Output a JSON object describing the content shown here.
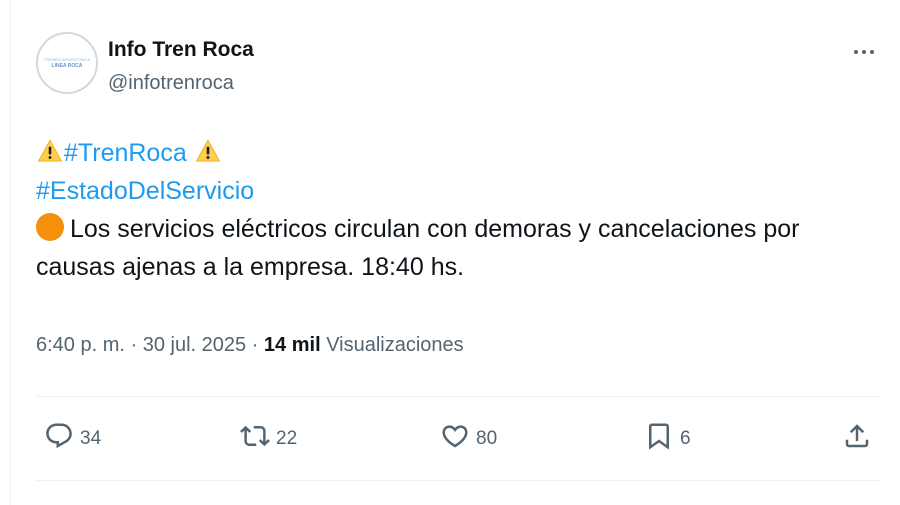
{
  "account": {
    "name": "Info Tren Roca",
    "handle": "@infotrenroca",
    "avatar_text_top": "TRENES ARGENTINOS",
    "avatar_text_bottom": "LINEA ROCA"
  },
  "tweet": {
    "hashtag_1": "#TrenRoca",
    "hashtag_2": "#EstadoDelServicio",
    "text_line_1": "Los servicios eléctricos circulan con demoras y cancelaciones por",
    "text_line_2": "causas ajenas a la empresa. 18:40 hs."
  },
  "meta": {
    "time": "6:40 p. m.",
    "separator": " · ",
    "date": "30 jul. 2025",
    "views_count": "14 mil",
    "views_label": "Visualizaciones"
  },
  "actions": {
    "replies": "34",
    "retweets": "22",
    "likes": "80",
    "bookmarks": "6"
  },
  "icons": {
    "warning": "warning-emoji",
    "status_dot": "orange-circle-emoji",
    "reply": "reply-icon",
    "retweet": "retweet-icon",
    "like": "heart-icon",
    "bookmark": "bookmark-icon",
    "share": "share-icon",
    "more": "more-icon"
  },
  "colors": {
    "link": "#1d9bf0",
    "secondary_text": "#536471",
    "primary_text": "#0f1419",
    "warning_yellow": "#ffcc4d",
    "orange_dot": "#f4900c"
  }
}
